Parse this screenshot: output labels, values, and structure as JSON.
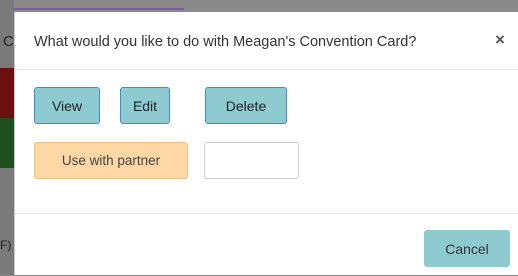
{
  "background": {
    "fragment_left_letter": "C",
    "fragment_bottom_text": "F)"
  },
  "dialog": {
    "title": "What would you like to do with Meagan's Convention Card?",
    "close_label": "×",
    "buttons": {
      "view": "View",
      "edit": "Edit",
      "delete": "Delete",
      "use_with_partner": "Use with partner",
      "cancel": "Cancel"
    },
    "partner_input": {
      "value": "",
      "placeholder": ""
    }
  },
  "colors": {
    "primary_button": "#8ecbd0",
    "primary_border": "#3f8fd0",
    "partner_button": "#fed8a4"
  }
}
